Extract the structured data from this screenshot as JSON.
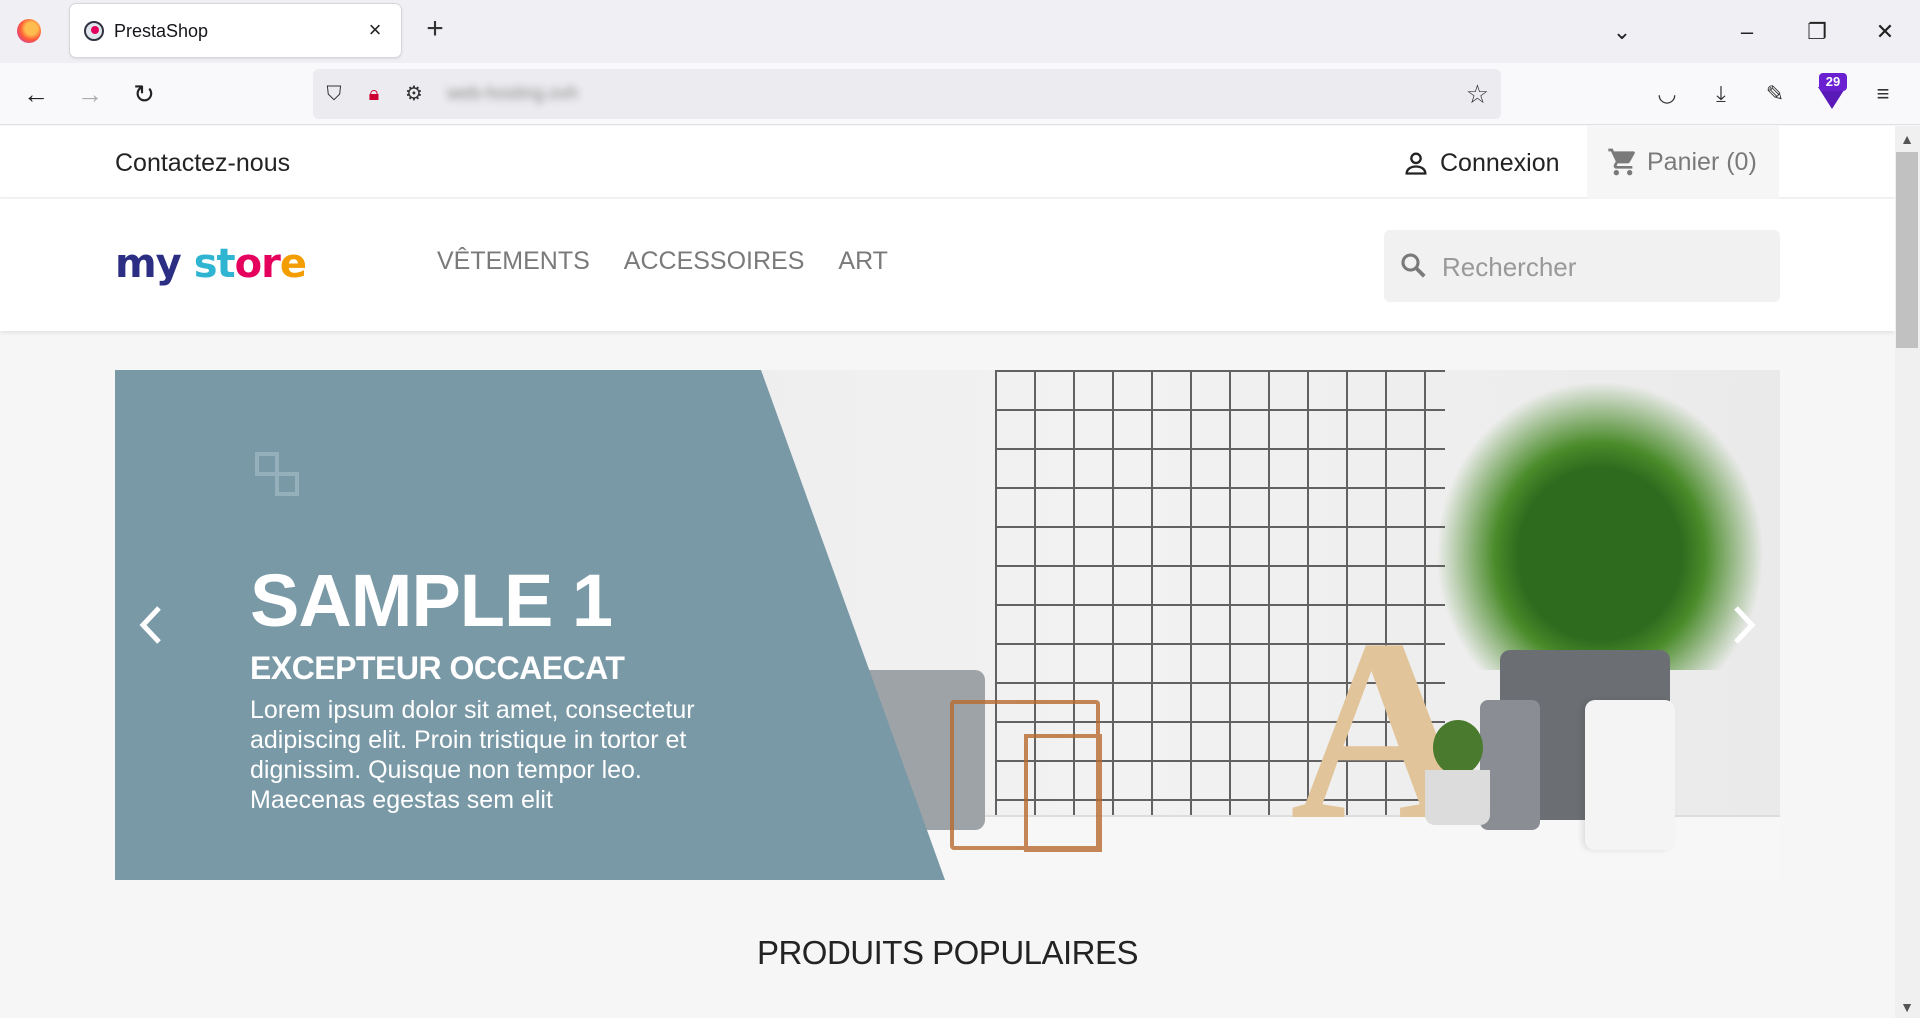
{
  "browser": {
    "tab_title": "PrestaShop",
    "url": "web-hosting.ovh",
    "extension_badge": "29"
  },
  "topbar": {
    "contact": "Contactez-nous",
    "login": "Connexion",
    "cart": "Panier (0)"
  },
  "header": {
    "logo_part1": "my",
    "logo_part2": "st",
    "logo_part3": "or",
    "logo_part4": "e",
    "menu": [
      "VÊTEMENTS",
      "ACCESSOIRES",
      "ART"
    ],
    "search_placeholder": "Rechercher"
  },
  "slider": {
    "title": "SAMPLE 1",
    "subtitle": "EXCEPTEUR OCCAECAT",
    "description": "Lorem ipsum dolor sit amet, consectetur adipiscing elit. Proin tristique in tortor et dignissim. Quisque non tempor leo. Maecenas egestas sem elit",
    "photo_letter": "A",
    "panel_color": "#7a99a6"
  },
  "section": {
    "title": "PRODUITS POPULAIRES"
  }
}
